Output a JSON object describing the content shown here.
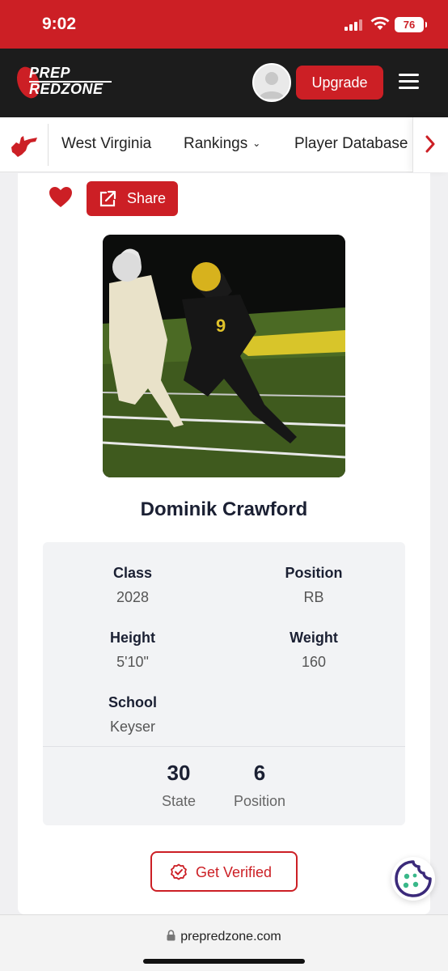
{
  "status_bar": {
    "time": "9:02",
    "battery": "76"
  },
  "header": {
    "logo_line1": "PREP",
    "logo_line2": "REDZONE",
    "upgrade_label": "Upgrade"
  },
  "nav": {
    "items": [
      {
        "label": "West Virginia"
      },
      {
        "label": "Rankings"
      },
      {
        "label": "Player Database"
      }
    ]
  },
  "profile": {
    "share_label": "Share",
    "name": "Dominik Crawford",
    "details": {
      "class_label": "Class",
      "class_value": "2028",
      "position_label": "Position",
      "position_value": "RB",
      "height_label": "Height",
      "height_value": "5'10\"",
      "weight_label": "Weight",
      "weight_value": "160",
      "school_label": "School",
      "school_value": "Keyser"
    },
    "rankings": [
      {
        "number": "30",
        "label": "State"
      },
      {
        "number": "6",
        "label": "Position"
      }
    ],
    "verify_label": "Get Verified"
  },
  "browser": {
    "url": "prepredzone.com"
  },
  "colors": {
    "brand_red": "#cc1f25",
    "header_dark": "#1c1c1c",
    "text_dark": "#1b2033"
  },
  "icons": [
    "signal-icon",
    "wifi-icon",
    "battery-icon",
    "user-avatar-icon",
    "hamburger-menu-icon",
    "west-virginia-state-icon",
    "chevron-down-icon",
    "chevron-right-icon",
    "heart-icon",
    "share-icon",
    "verified-check-icon",
    "cookie-icon",
    "lock-icon"
  ]
}
